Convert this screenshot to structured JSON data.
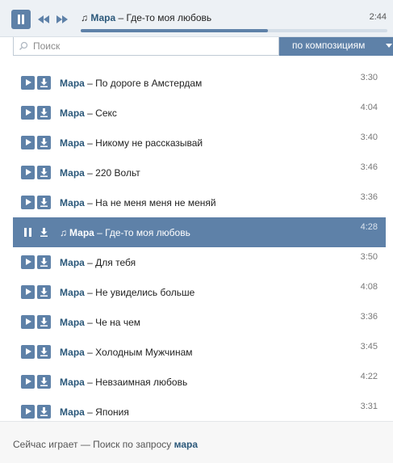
{
  "player": {
    "now_playing": {
      "note": "♫",
      "artist": "Мара",
      "dash": " – ",
      "song": "Где-то моя любовь"
    },
    "time": "2:44",
    "progress": 0.61
  },
  "search": {
    "placeholder": "Поиск",
    "mode_label": "по композициям"
  },
  "tracks": [
    {
      "artist": "Мара",
      "title": "По дороге в Амстердам",
      "duration": "3:30",
      "active": false
    },
    {
      "artist": "Мара",
      "title": "Секс",
      "duration": "4:04",
      "active": false
    },
    {
      "artist": "Мара",
      "title": "Никому не рассказывай",
      "duration": "3:40",
      "active": false
    },
    {
      "artist": "Мара",
      "title": "220 Вольт",
      "duration": "3:46",
      "active": false
    },
    {
      "artist": "Мара",
      "title": "На не меня меня не меняй",
      "duration": "3:36",
      "active": false
    },
    {
      "artist": "Мара",
      "title": "Где-то моя любовь",
      "duration": "4:28",
      "active": true
    },
    {
      "artist": "Мара",
      "title": "Для тебя",
      "duration": "3:50",
      "active": false
    },
    {
      "artist": "Мара",
      "title": "Не увиделись больше",
      "duration": "4:08",
      "active": false
    },
    {
      "artist": "Мара",
      "title": "Че на чем",
      "duration": "3:36",
      "active": false
    },
    {
      "artist": "Мара",
      "title": "Холодным Мужчинам",
      "duration": "3:45",
      "active": false
    },
    {
      "artist": "Мара",
      "title": "Невзаимная любовь",
      "duration": "4:22",
      "active": false
    },
    {
      "artist": "Мара",
      "title": "Япония",
      "duration": "3:31",
      "active": false
    }
  ],
  "footer": {
    "prefix": "Сейчас играет — Поиск по запросу ",
    "query": "мара"
  },
  "dash": " – ",
  "note": "♫",
  "colors": {
    "accent": "#5e81a8",
    "artist": "#2b587a",
    "bar_bg": "#edf1f5"
  },
  "icons": {
    "play": "play-icon",
    "pause": "pause-icon",
    "download": "download-icon",
    "prev": "prev-icon",
    "next": "next-icon",
    "search": "search-icon",
    "caret": "caret-down-icon"
  }
}
